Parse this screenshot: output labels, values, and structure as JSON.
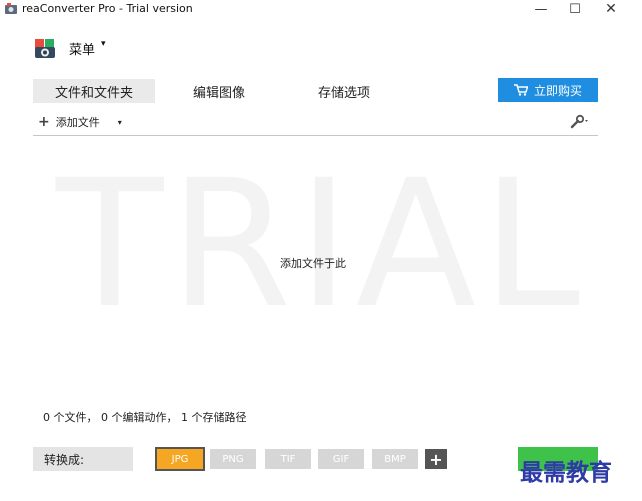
{
  "window": {
    "title": "reaConverter Pro - Trial version",
    "controls": {
      "minimize": "—",
      "maximize": "☐",
      "close": "✕"
    }
  },
  "menu": {
    "label": "菜单",
    "caret": "▾"
  },
  "tabs": [
    {
      "label": "文件和文件夹",
      "active": true
    },
    {
      "label": "编辑图像",
      "active": false
    },
    {
      "label": "存储选项",
      "active": false
    }
  ],
  "buy_button": {
    "label": "立即购买",
    "icon": "cart-icon",
    "color": "#1f8ee0"
  },
  "toolbar": {
    "add_file_label": "添加文件",
    "add_icon": "+",
    "caret": "▾",
    "settings_icon": "wrench-icon"
  },
  "drop_area": {
    "watermark": "TRIAL",
    "hint": "添加文件于此"
  },
  "status": {
    "summary": "0 个文件，  0 个编辑动作，  1 个存储路径"
  },
  "convert": {
    "label": "转换成:",
    "formats": [
      {
        "label": "JPG",
        "selected": true
      },
      {
        "label": "PNG",
        "selected": false
      },
      {
        "label": "TIF",
        "selected": false
      },
      {
        "label": "GIF",
        "selected": false
      },
      {
        "label": "BMP",
        "selected": false
      }
    ],
    "add_format": "+",
    "accent_color": "#f5a623"
  },
  "start_button": {
    "color": "#3fc24a"
  },
  "overlay_watermark": {
    "text": "最需教育",
    "color": "#2e3aa6"
  }
}
